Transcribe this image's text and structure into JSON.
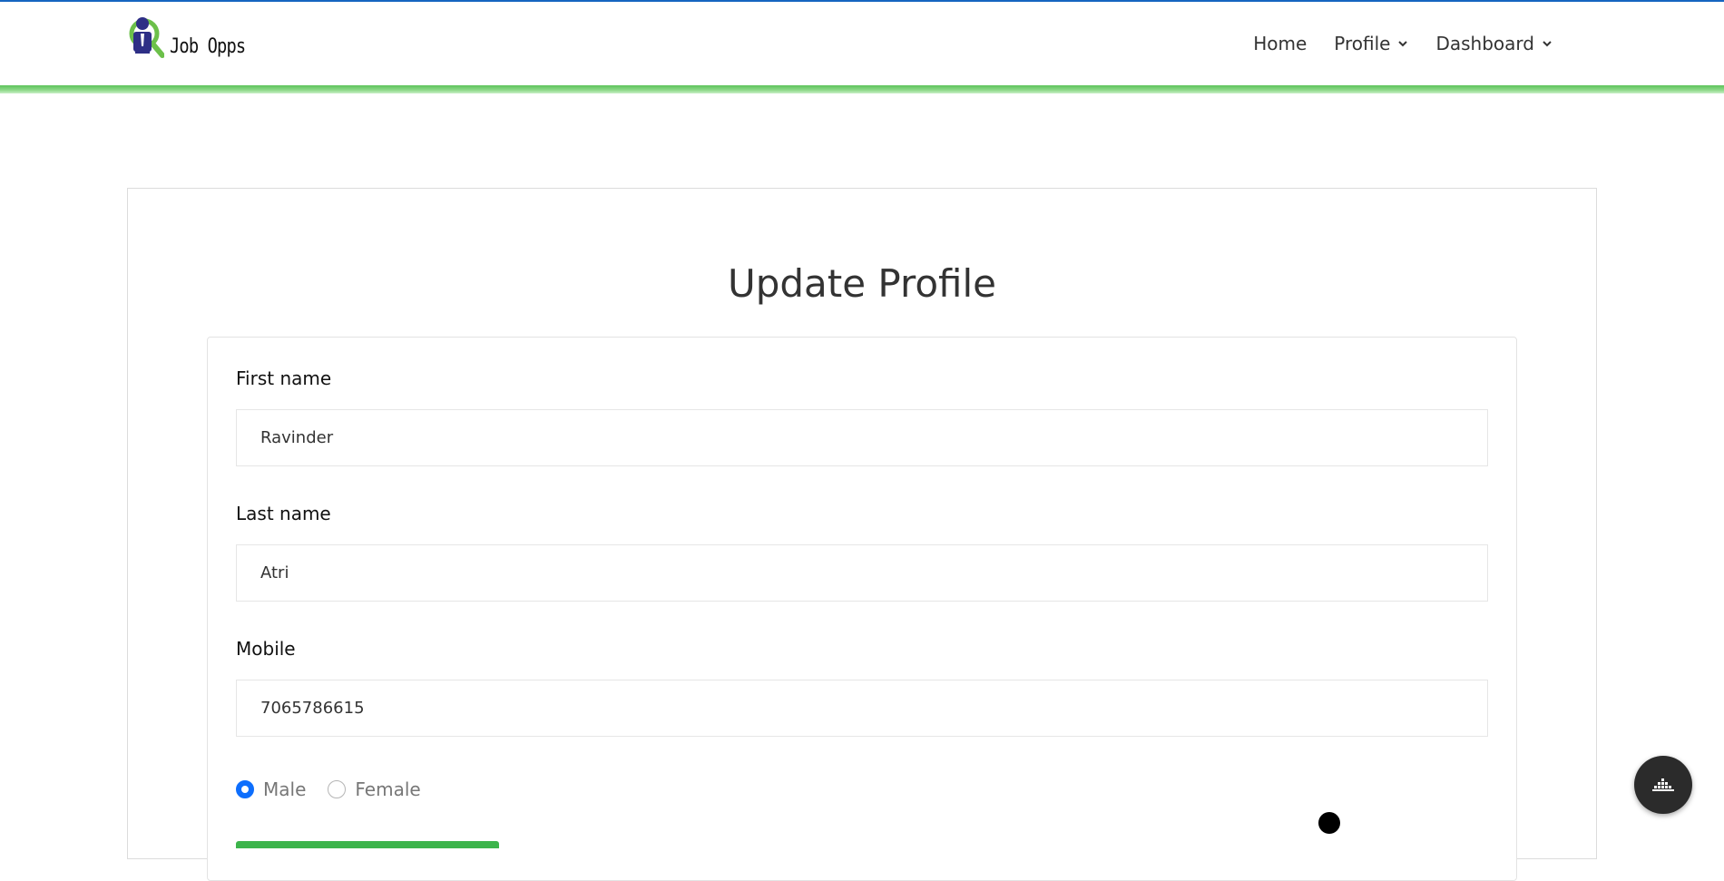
{
  "brand": {
    "name": "Job Opps"
  },
  "nav": {
    "home": "Home",
    "profile": "Profile",
    "dashboard": "Dashboard"
  },
  "page": {
    "title": "Update Profile"
  },
  "form": {
    "first_name": {
      "label": "First name",
      "value": "Ravinder"
    },
    "last_name": {
      "label": "Last name",
      "value": "Atri"
    },
    "mobile": {
      "label": "Mobile",
      "value": "7065786615"
    },
    "gender": {
      "options": [
        "Male",
        "Female"
      ],
      "selected": "Male"
    }
  },
  "icons": {
    "logo": "job-search-logo-icon",
    "nav_caret": "chevron-down-icon",
    "fab": "accessibility-icon"
  },
  "colors": {
    "accent_blue": "#0d6efd",
    "header_green": "#5cc35a",
    "logo_navy": "#2e2f86",
    "logo_green": "#6cc04a"
  }
}
